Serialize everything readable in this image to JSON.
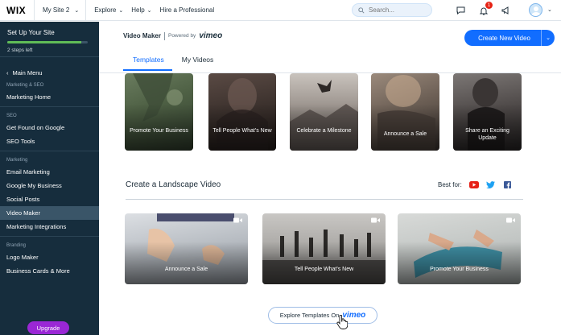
{
  "topbar": {
    "logo": "WIX",
    "site_name": "My Site 2",
    "nav": [
      "Explore",
      "Help",
      "Hire a Professional"
    ],
    "search_placeholder": "Search...",
    "notification_count": "1"
  },
  "sidebar": {
    "setup_title": "Set Up Your Site",
    "setup_progress": 0.92,
    "steps_left": "2 steps left",
    "back_label": "Main Menu",
    "groups": [
      {
        "heading": "Marketing & SEO",
        "items": [
          "Marketing Home"
        ]
      },
      {
        "heading": "SEO",
        "items": [
          "Get Found on Google",
          "SEO Tools"
        ]
      },
      {
        "heading": "Marketing",
        "items": [
          "Email Marketing",
          "Google My Business",
          "Social Posts",
          "Video Maker",
          "Marketing Integrations"
        ]
      },
      {
        "heading": "Branding",
        "items": [
          "Logo Maker",
          "Business Cards & More"
        ]
      }
    ],
    "active_item": "Video Maker",
    "upgrade_label": "Upgrade"
  },
  "header": {
    "title": "Video Maker",
    "powered_by": "Powered by",
    "vimeo": "vimeo",
    "create_button": "Create New Video",
    "tabs": [
      "Templates",
      "My Videos"
    ],
    "active_tab": "Templates"
  },
  "portrait_cards": [
    {
      "caption": "Promote Your Business"
    },
    {
      "caption": "Tell People What's New"
    },
    {
      "caption": "Celebrate a Milestone"
    },
    {
      "caption": "Announce a Sale"
    },
    {
      "caption": "Share an Exciting Update"
    }
  ],
  "landscape": {
    "title": "Create a Landscape Video",
    "best_for": "Best for:",
    "social_icons": [
      "youtube-icon",
      "twitter-icon",
      "facebook-icon"
    ],
    "cards": [
      {
        "caption": "Announce a Sale"
      },
      {
        "caption": "Tell People What's New"
      },
      {
        "caption": "Promote Your Business"
      }
    ]
  },
  "explore_button": {
    "text": "Explore Templates On",
    "brand": "vimeo"
  },
  "colors": {
    "accent": "#116dff",
    "sidebar_bg": "#162d3d",
    "upgrade": "#9a27d5",
    "progress": "#60bc57",
    "youtube": "#e62117",
    "twitter": "#1da1f2",
    "facebook": "#3b5998"
  }
}
